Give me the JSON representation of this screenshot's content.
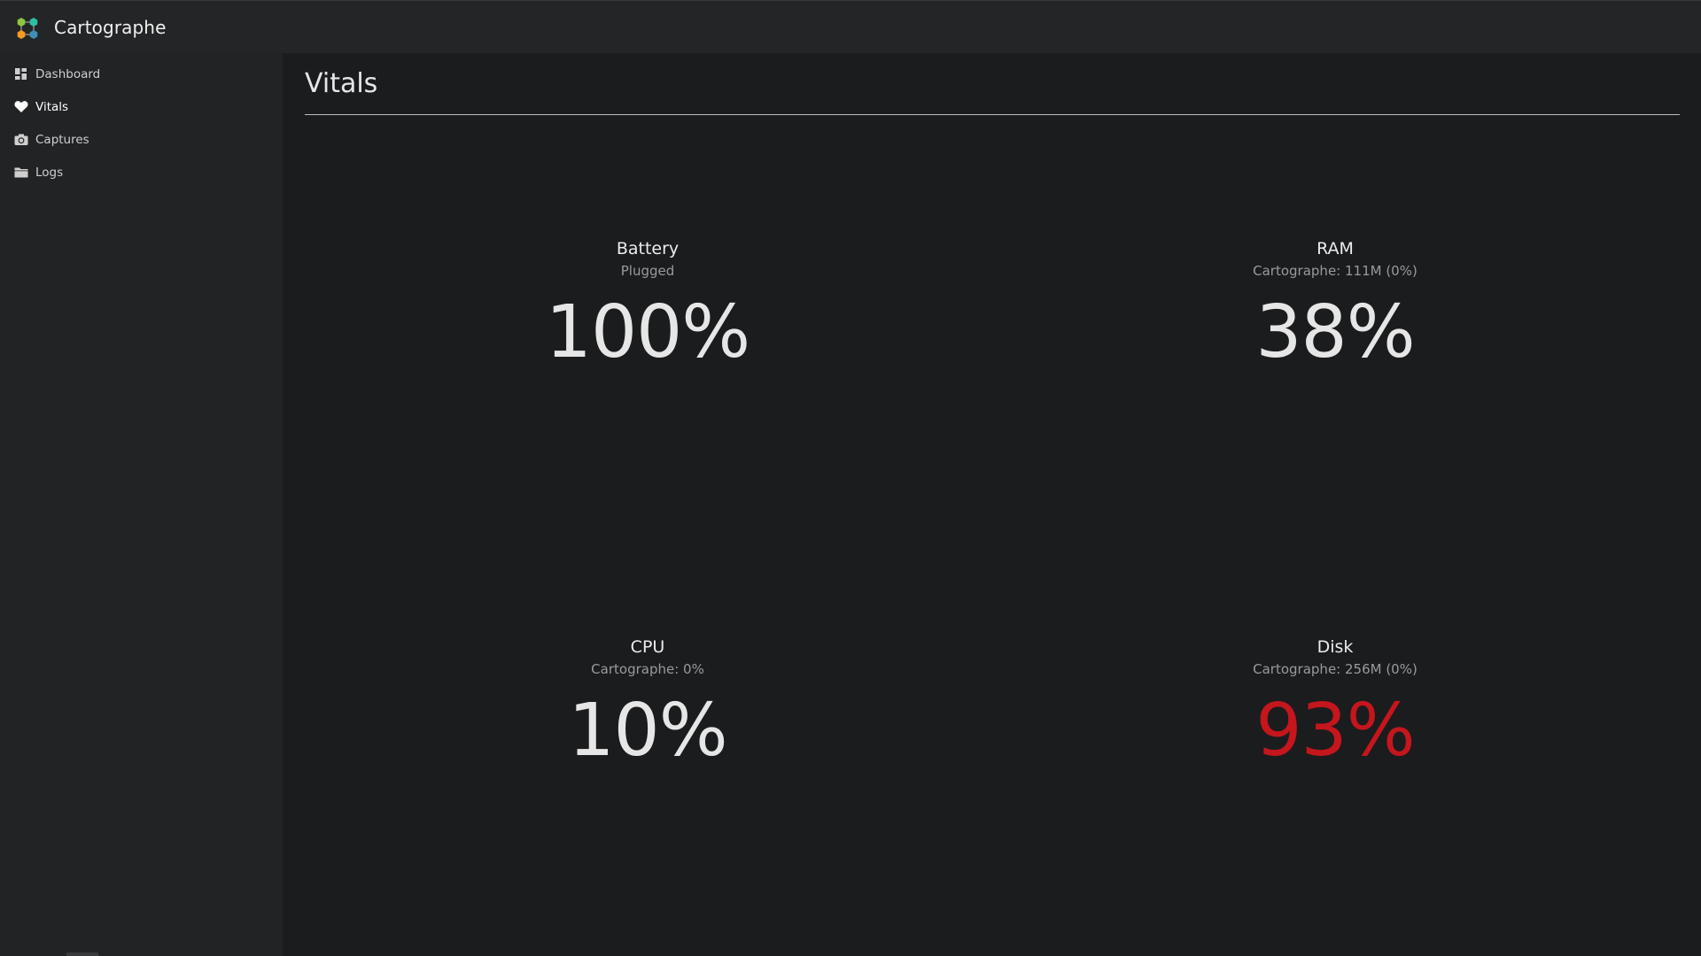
{
  "app": {
    "title": "Cartographe",
    "logo_icon": "cartographe-logo"
  },
  "sidebar": {
    "items": [
      {
        "label": "Dashboard",
        "icon": "dashboard-icon",
        "active": false
      },
      {
        "label": "Vitals",
        "icon": "heart-icon",
        "active": true
      },
      {
        "label": "Captures",
        "icon": "camera-icon",
        "active": false
      },
      {
        "label": "Logs",
        "icon": "folder-icon",
        "active": false
      }
    ]
  },
  "page": {
    "title": "Vitals"
  },
  "vitals": {
    "battery": {
      "name": "Battery",
      "sub": "Plugged",
      "value": "100%",
      "status": "normal"
    },
    "ram": {
      "name": "RAM",
      "sub": "Cartographe: 111M (0%)",
      "value": "38%",
      "status": "normal"
    },
    "cpu": {
      "name": "CPU",
      "sub": "Cartographe: 0%",
      "value": "10%",
      "status": "normal"
    },
    "disk": {
      "name": "Disk",
      "sub": "Cartographe: 256M (0%)",
      "value": "93%",
      "status": "critical"
    }
  },
  "colors": {
    "background": "#1b1c1e",
    "sidebar": "#222325",
    "topbar": "#242527",
    "critical": "#c4161c",
    "text": "#e6e6e6"
  }
}
